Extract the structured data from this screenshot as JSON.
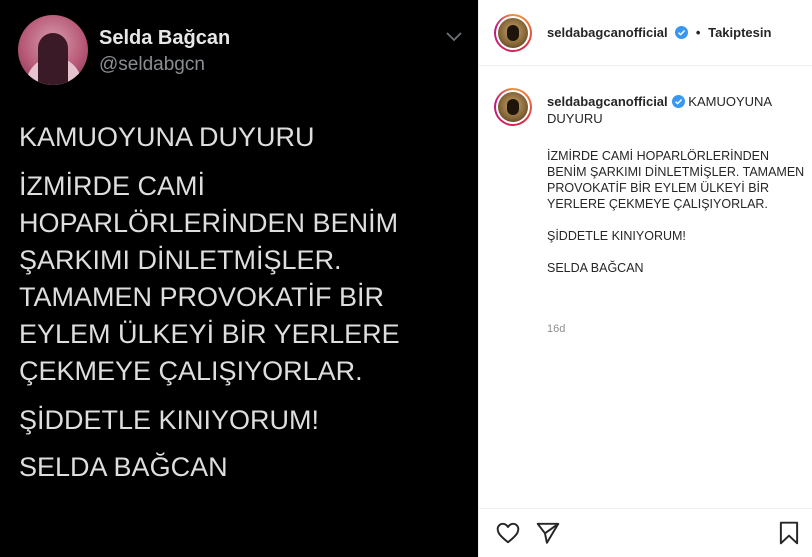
{
  "tweet": {
    "name": "Selda Bağcan",
    "handle": "@seldabgcn",
    "paragraphs": [
      "KAMUOYUNA DUYURU",
      "İZMİRDE CAMİ HOPARLÖRLERİNDEN BENİM ŞARKIMI DİNLETMİŞLER. TAMAMEN PROVOKATİF BİR EYLEM ÜLKEYİ BİR YERLERE ÇEKMEYE ÇALIŞIYORLAR.",
      "ŞİDDETLE KINIYORUM!",
      "SELDA BAĞCAN"
    ]
  },
  "instagram": {
    "username": "seldabagcanofficial",
    "separator": "•",
    "follow_status": "Takiptesin",
    "caption_title": "KAMUOYUNA DUYURU",
    "caption_paragraphs": [
      "İZMİRDE CAMİ HOPARLÖRLERİNDEN BENİM ŞARKIMI DİNLETMİŞLER. TAMAMEN PROVOKATİF BİR EYLEM ÜLKEYİ BİR YERLERE ÇEKMEYE ÇALIŞIYORLAR.",
      "ŞİDDETLE KINIYORUM!",
      "SELDA BAĞCAN"
    ],
    "timestamp": "16d",
    "icons": {
      "like": "heart-icon",
      "share": "paper-plane-icon",
      "save": "bookmark-icon",
      "verified": "verified-badge-icon"
    },
    "colors": {
      "verified": "#3897f0",
      "tweet_bg": "#000000"
    }
  }
}
